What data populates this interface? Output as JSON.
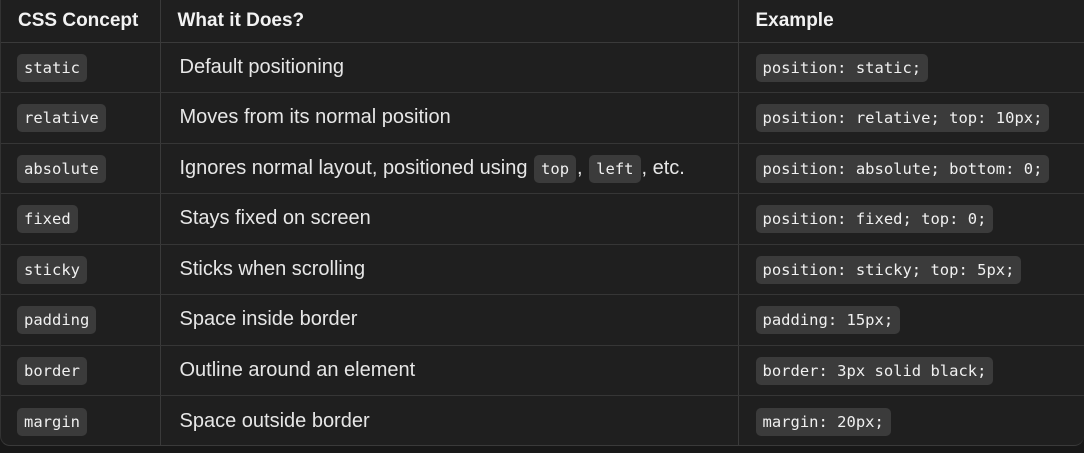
{
  "table": {
    "headers": [
      "CSS Concept",
      "What it Does?",
      "Example"
    ],
    "rows": [
      {
        "concept": "static",
        "description": "Default positioning",
        "example": "position: static;"
      },
      {
        "concept": "relative",
        "description": "Moves from its normal position",
        "example": "position: relative; top: 10px;"
      },
      {
        "concept": "absolute",
        "description_parts": [
          "Ignores normal layout, positioned using ",
          "top",
          ", ",
          "left",
          ", etc."
        ],
        "example": "position: absolute; bottom: 0;"
      },
      {
        "concept": "fixed",
        "description": "Stays fixed on screen",
        "example": "position: fixed; top: 0;"
      },
      {
        "concept": "sticky",
        "description": "Sticks when scrolling",
        "example": "position: sticky; top: 5px;"
      },
      {
        "concept": "padding",
        "description": "Space inside border",
        "example": "padding: 15px;"
      },
      {
        "concept": "border",
        "description": "Outline around an element",
        "example": "border: 3px solid black;"
      },
      {
        "concept": "margin",
        "description": "Space outside border",
        "example": "margin: 20px;"
      }
    ]
  }
}
